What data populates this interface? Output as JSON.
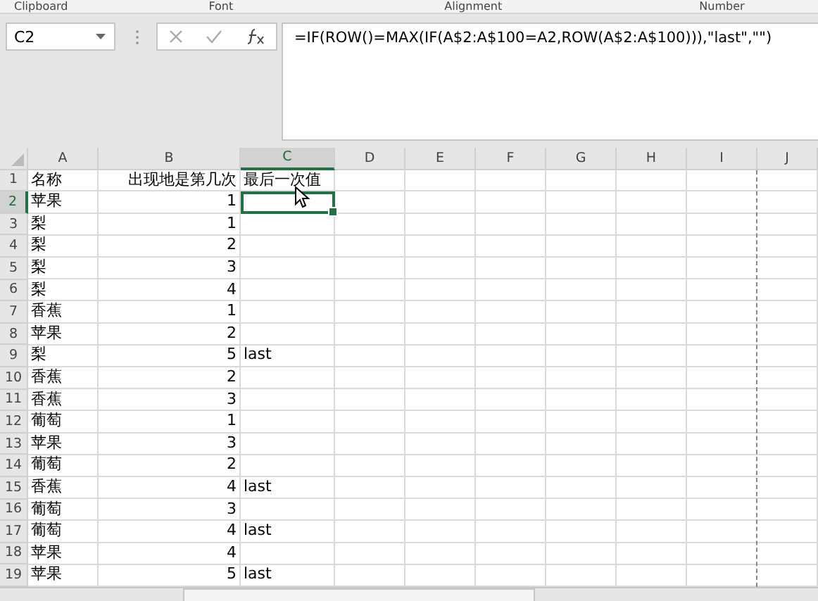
{
  "ribbon_groups": [
    "Clipboard",
    "Font",
    "Alignment",
    "Number"
  ],
  "name_box": {
    "value": "C2"
  },
  "formula_bar": {
    "value": "=IF(ROW()=MAX(IF(A$2:A$100=A2,ROW(A$2:A$100))),\"last\",\"\")"
  },
  "columns": [
    {
      "label": "A",
      "selected": false
    },
    {
      "label": "B",
      "selected": false
    },
    {
      "label": "C",
      "selected": true
    },
    {
      "label": "D",
      "selected": false
    },
    {
      "label": "E",
      "selected": false
    },
    {
      "label": "F",
      "selected": false
    },
    {
      "label": "G",
      "selected": false
    },
    {
      "label": "H",
      "selected": false
    },
    {
      "label": "I",
      "selected": false
    },
    {
      "label": "J",
      "selected": false
    }
  ],
  "rows": [
    {
      "number": "1",
      "selected": false,
      "cells": [
        "名称",
        "出现地是第几次",
        "最后一次值"
      ]
    },
    {
      "number": "2",
      "selected": true,
      "cells": [
        "苹果",
        "1",
        ""
      ]
    },
    {
      "number": "3",
      "selected": false,
      "cells": [
        "梨",
        "1",
        ""
      ]
    },
    {
      "number": "4",
      "selected": false,
      "cells": [
        "梨",
        "2",
        ""
      ]
    },
    {
      "number": "5",
      "selected": false,
      "cells": [
        "梨",
        "3",
        ""
      ]
    },
    {
      "number": "6",
      "selected": false,
      "cells": [
        "梨",
        "4",
        ""
      ]
    },
    {
      "number": "7",
      "selected": false,
      "cells": [
        "香蕉",
        "1",
        ""
      ]
    },
    {
      "number": "8",
      "selected": false,
      "cells": [
        "苹果",
        "2",
        ""
      ]
    },
    {
      "number": "9",
      "selected": false,
      "cells": [
        "梨",
        "5",
        "last"
      ]
    },
    {
      "number": "10",
      "selected": false,
      "cells": [
        "香蕉",
        "2",
        ""
      ]
    },
    {
      "number": "11",
      "selected": false,
      "cells": [
        "香蕉",
        "3",
        ""
      ]
    },
    {
      "number": "12",
      "selected": false,
      "cells": [
        "葡萄",
        "1",
        ""
      ]
    },
    {
      "number": "13",
      "selected": false,
      "cells": [
        "苹果",
        "3",
        ""
      ]
    },
    {
      "number": "14",
      "selected": false,
      "cells": [
        "葡萄",
        "2",
        ""
      ]
    },
    {
      "number": "15",
      "selected": false,
      "cells": [
        "香蕉",
        "4",
        "last"
      ]
    },
    {
      "number": "16",
      "selected": false,
      "cells": [
        "葡萄",
        "3",
        ""
      ]
    },
    {
      "number": "17",
      "selected": false,
      "cells": [
        "葡萄",
        "4",
        "last"
      ]
    },
    {
      "number": "18",
      "selected": false,
      "cells": [
        "苹果",
        "4",
        ""
      ]
    },
    {
      "number": "19",
      "selected": false,
      "cells": [
        "苹果",
        "5",
        "last"
      ]
    }
  ]
}
